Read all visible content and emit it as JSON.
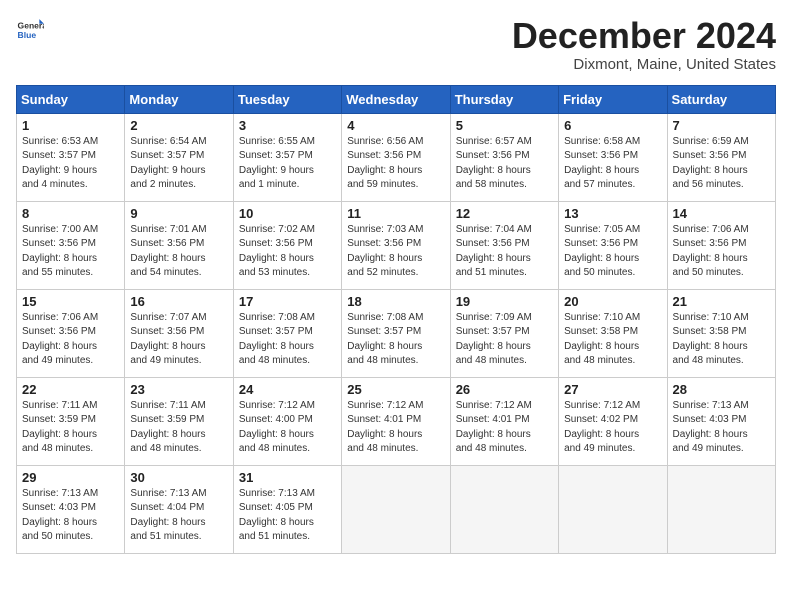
{
  "header": {
    "logo_general": "General",
    "logo_blue": "Blue",
    "title": "December 2024",
    "subtitle": "Dixmont, Maine, United States"
  },
  "weekdays": [
    "Sunday",
    "Monday",
    "Tuesday",
    "Wednesday",
    "Thursday",
    "Friday",
    "Saturday"
  ],
  "weeks": [
    [
      {
        "day": 1,
        "info": "Sunrise: 6:53 AM\nSunset: 3:57 PM\nDaylight: 9 hours\nand 4 minutes."
      },
      {
        "day": 2,
        "info": "Sunrise: 6:54 AM\nSunset: 3:57 PM\nDaylight: 9 hours\nand 2 minutes."
      },
      {
        "day": 3,
        "info": "Sunrise: 6:55 AM\nSunset: 3:57 PM\nDaylight: 9 hours\nand 1 minute."
      },
      {
        "day": 4,
        "info": "Sunrise: 6:56 AM\nSunset: 3:56 PM\nDaylight: 8 hours\nand 59 minutes."
      },
      {
        "day": 5,
        "info": "Sunrise: 6:57 AM\nSunset: 3:56 PM\nDaylight: 8 hours\nand 58 minutes."
      },
      {
        "day": 6,
        "info": "Sunrise: 6:58 AM\nSunset: 3:56 PM\nDaylight: 8 hours\nand 57 minutes."
      },
      {
        "day": 7,
        "info": "Sunrise: 6:59 AM\nSunset: 3:56 PM\nDaylight: 8 hours\nand 56 minutes."
      }
    ],
    [
      {
        "day": 8,
        "info": "Sunrise: 7:00 AM\nSunset: 3:56 PM\nDaylight: 8 hours\nand 55 minutes."
      },
      {
        "day": 9,
        "info": "Sunrise: 7:01 AM\nSunset: 3:56 PM\nDaylight: 8 hours\nand 54 minutes."
      },
      {
        "day": 10,
        "info": "Sunrise: 7:02 AM\nSunset: 3:56 PM\nDaylight: 8 hours\nand 53 minutes."
      },
      {
        "day": 11,
        "info": "Sunrise: 7:03 AM\nSunset: 3:56 PM\nDaylight: 8 hours\nand 52 minutes."
      },
      {
        "day": 12,
        "info": "Sunrise: 7:04 AM\nSunset: 3:56 PM\nDaylight: 8 hours\nand 51 minutes."
      },
      {
        "day": 13,
        "info": "Sunrise: 7:05 AM\nSunset: 3:56 PM\nDaylight: 8 hours\nand 50 minutes."
      },
      {
        "day": 14,
        "info": "Sunrise: 7:06 AM\nSunset: 3:56 PM\nDaylight: 8 hours\nand 50 minutes."
      }
    ],
    [
      {
        "day": 15,
        "info": "Sunrise: 7:06 AM\nSunset: 3:56 PM\nDaylight: 8 hours\nand 49 minutes."
      },
      {
        "day": 16,
        "info": "Sunrise: 7:07 AM\nSunset: 3:56 PM\nDaylight: 8 hours\nand 49 minutes."
      },
      {
        "day": 17,
        "info": "Sunrise: 7:08 AM\nSunset: 3:57 PM\nDaylight: 8 hours\nand 48 minutes."
      },
      {
        "day": 18,
        "info": "Sunrise: 7:08 AM\nSunset: 3:57 PM\nDaylight: 8 hours\nand 48 minutes."
      },
      {
        "day": 19,
        "info": "Sunrise: 7:09 AM\nSunset: 3:57 PM\nDaylight: 8 hours\nand 48 minutes."
      },
      {
        "day": 20,
        "info": "Sunrise: 7:10 AM\nSunset: 3:58 PM\nDaylight: 8 hours\nand 48 minutes."
      },
      {
        "day": 21,
        "info": "Sunrise: 7:10 AM\nSunset: 3:58 PM\nDaylight: 8 hours\nand 48 minutes."
      }
    ],
    [
      {
        "day": 22,
        "info": "Sunrise: 7:11 AM\nSunset: 3:59 PM\nDaylight: 8 hours\nand 48 minutes."
      },
      {
        "day": 23,
        "info": "Sunrise: 7:11 AM\nSunset: 3:59 PM\nDaylight: 8 hours\nand 48 minutes."
      },
      {
        "day": 24,
        "info": "Sunrise: 7:12 AM\nSunset: 4:00 PM\nDaylight: 8 hours\nand 48 minutes."
      },
      {
        "day": 25,
        "info": "Sunrise: 7:12 AM\nSunset: 4:01 PM\nDaylight: 8 hours\nand 48 minutes."
      },
      {
        "day": 26,
        "info": "Sunrise: 7:12 AM\nSunset: 4:01 PM\nDaylight: 8 hours\nand 48 minutes."
      },
      {
        "day": 27,
        "info": "Sunrise: 7:12 AM\nSunset: 4:02 PM\nDaylight: 8 hours\nand 49 minutes."
      },
      {
        "day": 28,
        "info": "Sunrise: 7:13 AM\nSunset: 4:03 PM\nDaylight: 8 hours\nand 49 minutes."
      }
    ],
    [
      {
        "day": 29,
        "info": "Sunrise: 7:13 AM\nSunset: 4:03 PM\nDaylight: 8 hours\nand 50 minutes."
      },
      {
        "day": 30,
        "info": "Sunrise: 7:13 AM\nSunset: 4:04 PM\nDaylight: 8 hours\nand 51 minutes."
      },
      {
        "day": 31,
        "info": "Sunrise: 7:13 AM\nSunset: 4:05 PM\nDaylight: 8 hours\nand 51 minutes."
      },
      null,
      null,
      null,
      null
    ]
  ]
}
